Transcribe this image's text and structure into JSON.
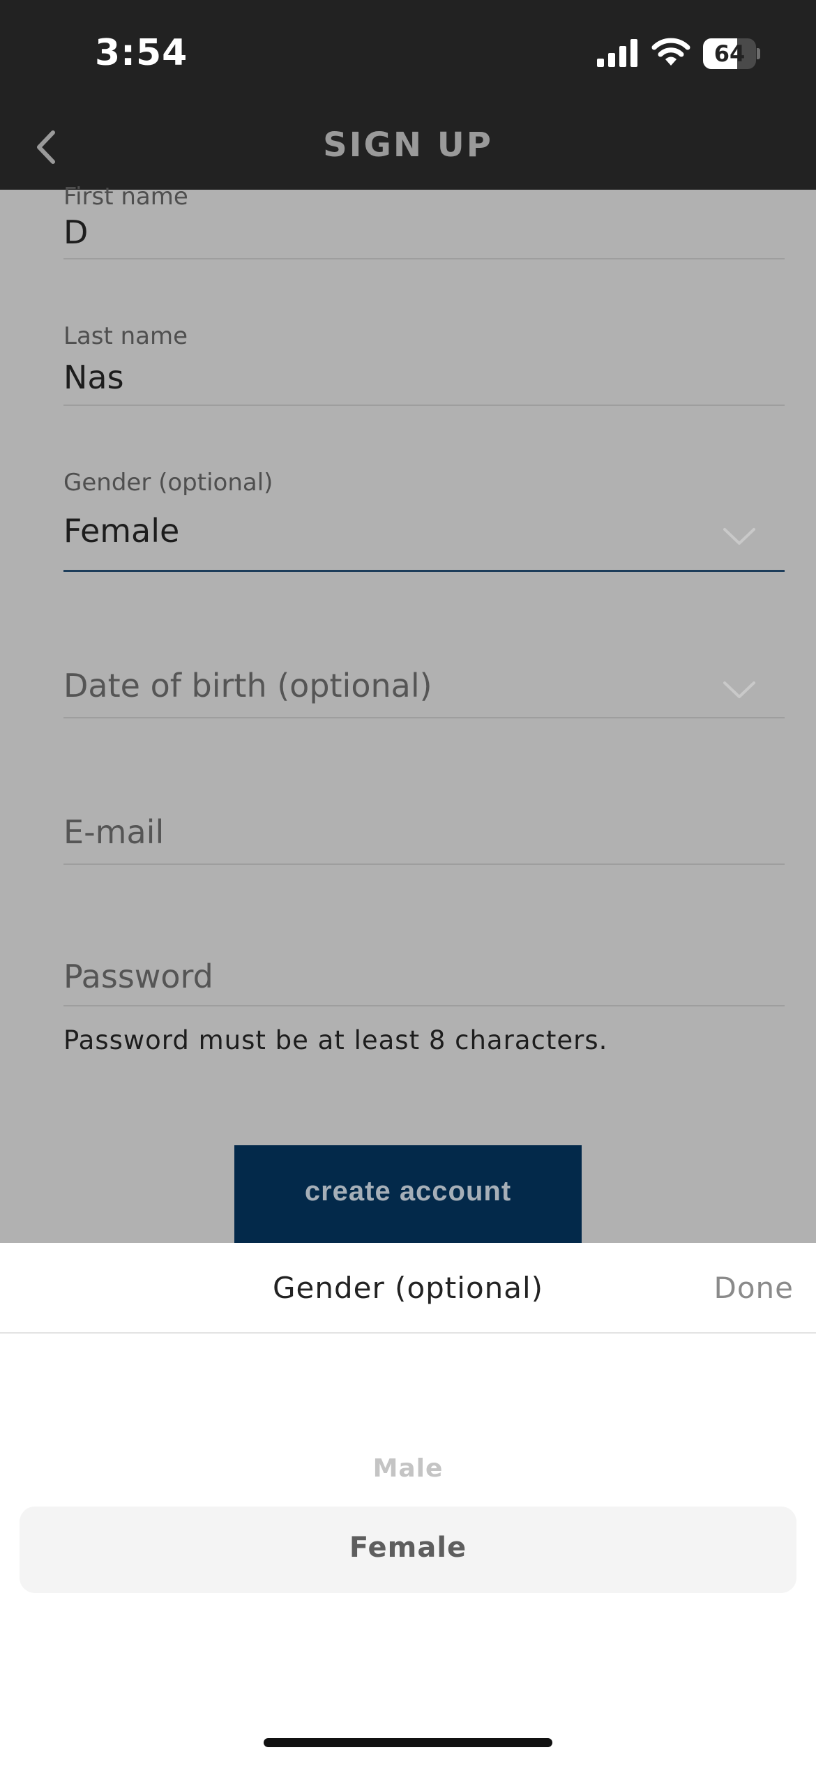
{
  "status_bar": {
    "time": "3:54",
    "battery": "64",
    "battery_level_percent": 64
  },
  "nav": {
    "title": "SIGN UP",
    "back_icon": "chevron-left-icon"
  },
  "form": {
    "first_name": {
      "label": "First name",
      "value": "D"
    },
    "last_name": {
      "label": "Last name",
      "value": "Nas"
    },
    "gender": {
      "label": "Gender (optional)",
      "value": "Female",
      "icon": "chevron-down-icon"
    },
    "date_of_birth": {
      "placeholder": "Date of birth (optional)",
      "icon": "chevron-down-icon"
    },
    "email": {
      "placeholder": "E-mail"
    },
    "password": {
      "placeholder": "Password",
      "hint": "Password must be at least 8 characters."
    }
  },
  "create_button_label": "create account",
  "picker": {
    "title": "Gender (optional)",
    "done_label": "Done",
    "options": [
      "Male",
      "Female"
    ],
    "selected": "Female"
  },
  "colors": {
    "header_bg": "#222222",
    "overlay_bg": "#b1b1b1",
    "button_bg": "#03294a",
    "active_underline": "#1d3d5a",
    "sheet_bg": "#ffffff"
  }
}
